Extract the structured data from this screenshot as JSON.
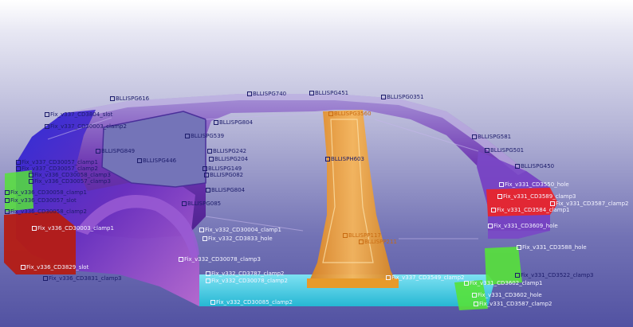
{
  "viewport": {
    "background_top": "#ffffff",
    "background_bottom": "#5252a2",
    "colors": {
      "side_frame": "#6a2fb0",
      "b_pillar": "#f2a13a",
      "rocker": "#33d0e8",
      "rear_panel": "#b51c14",
      "front_bracket": "#e8262c",
      "clamp_parts": "#56e23a"
    }
  },
  "labels": {
    "clamp_rear_upper": "Fix_v337_CD3804_slot",
    "clamp_rear_mid": "Fix_v337_CD30003_clamp2",
    "clamp_rear_a": "Fix_v337_CD30057_clamp1",
    "clamp_rear_b": "Fix_v337_CD30057_clamp2",
    "clamp_rear_c": "Fix_v336_CD30058_clamp3",
    "clamp_rear_d": "Fix_v336_CD30057_clamp3",
    "clamp_rear_e": "Fix_v336_CD30058_clamp1",
    "clamp_rear_f": "Fix_v336_CD30057_slot",
    "clamp_rear_g": "Fix_v336_CD30058_clamp2",
    "clamp_rear_h": "Fix_v336_CD30003_clamp1",
    "clamp_rear_bottom1": "Fix_v336_CD3829_slot",
    "clamp_rear_bottom2": "Fix_v336_CD3831_clamp3",
    "clamp_center_1": "Fix_v332_CD30004_clamp1",
    "clamp_center_2": "Fix_v332_CD3833_hole",
    "clamp_center_3": "Fix_v332_CD30078_clamp3",
    "clamp_center_4": "Fix_v332_CD3787_clamp2",
    "clamp_center_5": "Fix_v332_CD30078_clamp2",
    "clamp_bottom_center": "Fix_v337_CD3549_clamp2",
    "clamp_bottom_rocker": "Fix_v332_CD30085_clamp2",
    "clamp_front_1": "Fix_v331_CD3550_hole",
    "clamp_front_2": "Fix_v331_CD3584_clamp1",
    "clamp_front_3": "Fix_v331_CD3587_clamp2",
    "clamp_front_4": "Fix_v331_CD3589_clamp3",
    "clamp_front_5": "Fix_v331_CD3609_hole",
    "clamp_front_6": "Fix_v331_CD3588_hole",
    "clamp_front_7": "Fix_v331_CD3522_clamp3",
    "clamp_front_8": "Fix_v331_CD3602_clamp1",
    "clamp_front_9": "Fix_v331_CD3602_hole",
    "clamp_front_10": "Fix_v331_CD3587_clamp2",
    "ref_1": "BLLISPG740",
    "ref_2": "BLLISPG616",
    "ref_3": "BLLISPG451",
    "ref_4": "BLLISPG0351",
    "ref_5": "BLLISPG539",
    "ref_6": "BLLISPG581",
    "ref_7": "BLLISPG804",
    "ref_8": "BLLISPG242",
    "ref_9": "BLLISPG204",
    "ref_10": "BLLISPG149",
    "ref_11": "BLLISPG082",
    "ref_12": "BLLISPG804",
    "ref_13": "BLLISPG849",
    "ref_14": "BLLISPG446",
    "ref_15": "BLLISPG085",
    "ref_16": "BLLISPG501",
    "ref_17": "BLLISPG450",
    "ref_18": "BLLISPH603",
    "ref_19": "BLLISPP117",
    "ref_20": "BLLISPP211",
    "ref_21": "BLLISPG3560"
  }
}
